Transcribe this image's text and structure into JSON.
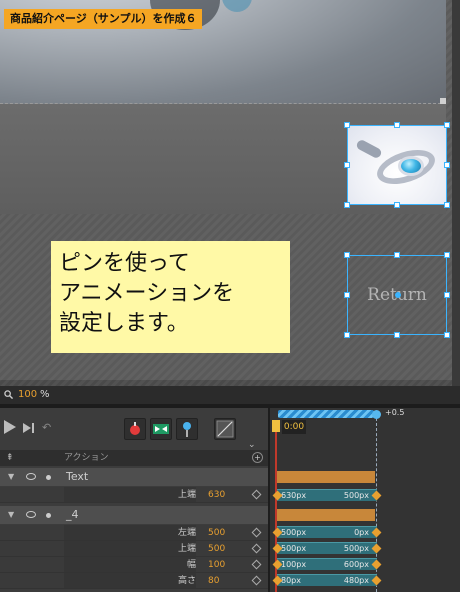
{
  "stage": {
    "title_badge": "商品紹介ページ（サンプル）を作成６",
    "callout_text": "ピンを使って\nアニメーションを\n設定します。",
    "return_label": "Return"
  },
  "zoom": {
    "value": "100",
    "unit": "%"
  },
  "timeline": {
    "header_action": "アクション",
    "time": "0:00",
    "ruler_label": "+0.5",
    "layers": [
      {
        "name": "Text",
        "props": [
          {
            "label": "上端",
            "value": "630",
            "start": "630px",
            "end": "500px"
          }
        ]
      },
      {
        "name": "_4",
        "props": [
          {
            "label": "左端",
            "value": "500",
            "start": "500px",
            "end": "0px"
          },
          {
            "label": "上端",
            "value": "500",
            "start": "500px",
            "end": "500px"
          },
          {
            "label": "幅",
            "value": "100",
            "start": "100px",
            "end": "600px"
          },
          {
            "label": "高さ",
            "value": "80",
            "start": "80px",
            "end": "480px"
          }
        ]
      }
    ]
  },
  "colors": {
    "accent": "#f5a623",
    "selection": "#3ab4ff",
    "keyframe": "#e8a030",
    "callout_bg": "#fff9a6"
  },
  "icons": [
    "zoom-icon",
    "play-icon",
    "step-forward-icon",
    "undo-icon",
    "record-icon",
    "fit-icon",
    "pin-icon",
    "ease-icon",
    "eye-icon",
    "lock-dot-icon",
    "keyframe-diamond-icon"
  ]
}
